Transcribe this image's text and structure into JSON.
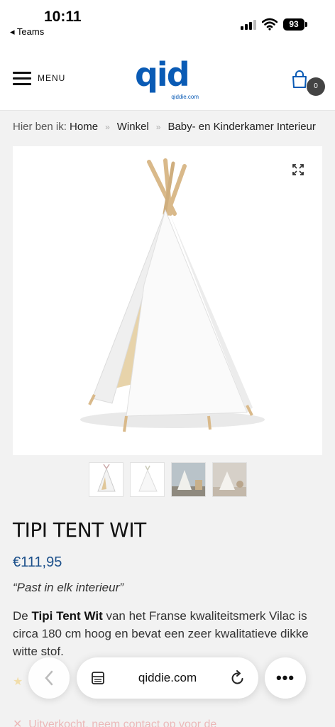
{
  "status": {
    "time": "10:11",
    "back_app": "◂ Teams",
    "battery": "93"
  },
  "header": {
    "menu_label": "MENU",
    "logo_text": "qid",
    "logo_sub": "qiddie.com",
    "cart_count": "0"
  },
  "breadcrumb": {
    "prefix": "Hier ben ik:",
    "items": [
      "Home",
      "Winkel",
      "Baby- en Kinderkamer Interieur"
    ],
    "separator": "»"
  },
  "product": {
    "title": "TIPI TENT WIT",
    "price": "€111,95",
    "tagline": "“Past in elk interieur”",
    "desc_pre": "De ",
    "desc_bold": "Tipi Tent Wit",
    "desc_post": " van het Franse kwaliteitsmerk Vilac is circa 180 cm hoog en bevat een zeer kwalitatieve dikke witte stof."
  },
  "faded": {
    "alert": "Uitverkocht, neem contact op voor de"
  },
  "browser": {
    "url": "qiddie.com",
    "more": "•••"
  },
  "colors": {
    "brand_blue": "#0a5bb5",
    "price_blue": "#1b4f8a"
  }
}
